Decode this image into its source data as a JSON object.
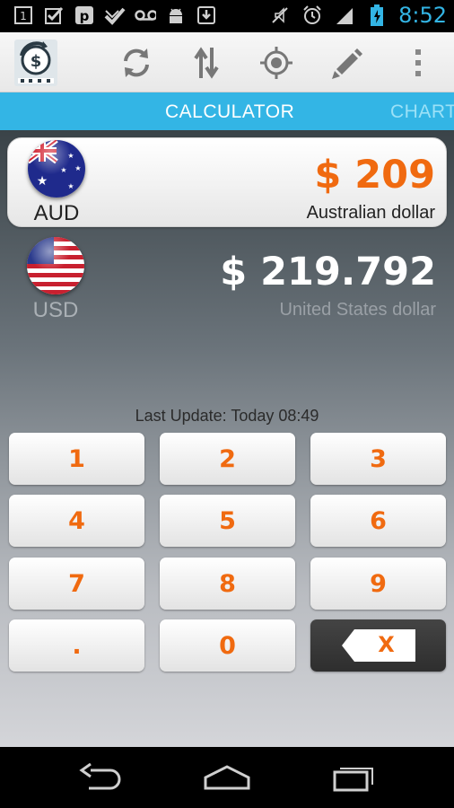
{
  "status_bar": {
    "time": "8:52",
    "notification_icons": [
      "notification-1-icon",
      "checkbox-icon",
      "parking-icon",
      "checkmark-icon",
      "voicemail-icon",
      "android-icon",
      "download-icon"
    ],
    "system_icons": [
      "mute-icon",
      "alarm-icon",
      "signal-icon",
      "battery-icon"
    ]
  },
  "action_bar": {
    "icons": [
      "app-logo-icon",
      "refresh-icon",
      "swap-icon",
      "locate-icon",
      "edit-icon",
      "overflow-menu-icon"
    ]
  },
  "tabs": [
    {
      "label": "CALCULATOR",
      "selected": true
    },
    {
      "label": "CHART",
      "selected": false
    }
  ],
  "currencies": {
    "from": {
      "code": "AUD",
      "symbol_amount": "$ 209",
      "name": "Australian dollar"
    },
    "to": {
      "code": "USD",
      "symbol_amount": "$ 219.792",
      "name": "United States dollar"
    }
  },
  "last_update": "Last Update: Today 08:49",
  "keypad": {
    "keys": [
      "1",
      "2",
      "3",
      "4",
      "5",
      "6",
      "7",
      "8",
      "9",
      ".",
      "0"
    ],
    "delete_label": "X"
  },
  "colors": {
    "accent": "#33b5e5",
    "amount": "#f06a10"
  },
  "nav_bar": {
    "icons": [
      "back-icon",
      "home-icon",
      "recent-apps-icon"
    ]
  }
}
